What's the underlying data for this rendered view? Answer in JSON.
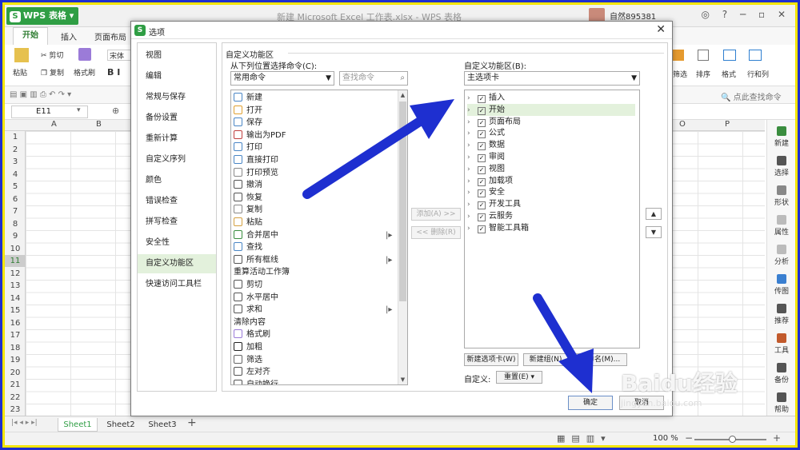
{
  "titlebar": {
    "app_name": "WPS 表格",
    "doc_title": "新建 Microsoft Excel 工作表.xlsx - WPS 表格",
    "user": "自然895381"
  },
  "ribbon": {
    "tabs": [
      "开始",
      "插入",
      "页面布局"
    ],
    "items": {
      "paste": "粘贴",
      "cut": "剪切",
      "copy": "复制",
      "format_painter": "格式刷",
      "font": "宋体",
      "filter": "筛选",
      "sort": "排序",
      "format": "格式",
      "rows_cols": "行和列",
      "find": "点此查找命令"
    }
  },
  "formula_bar": {
    "cell_ref": "E11"
  },
  "grid": {
    "columns": [
      "A",
      "B",
      "O",
      "P"
    ],
    "rows": [
      "1",
      "2",
      "3",
      "4",
      "5",
      "6",
      "7",
      "8",
      "9",
      "10",
      "11",
      "12",
      "13",
      "14",
      "15",
      "16",
      "17",
      "18",
      "19",
      "20",
      "21",
      "22",
      "23"
    ]
  },
  "right_sidebar": [
    "新建",
    "选择",
    "形状",
    "属性",
    "分析",
    "传图",
    "推荐",
    "工具",
    "备份",
    "帮助"
  ],
  "sheets": [
    "Sheet1",
    "Sheet2",
    "Sheet3"
  ],
  "status": {
    "zoom": "100 %"
  },
  "dialog": {
    "title": "选项",
    "nav": [
      "视图",
      "编辑",
      "常规与保存",
      "备份设置",
      "重新计算",
      "自定义序列",
      "颜色",
      "错误检查",
      "拼写检查",
      "安全性",
      "自定义功能区",
      "快速访问工具栏"
    ],
    "selected_nav": "自定义功能区",
    "section_title": "自定义功能区",
    "left": {
      "label": "从下列位置选择命令(C):",
      "combo": "常用命令",
      "search_placeholder": "查找命令",
      "commands": [
        "新建",
        "打开",
        "保存",
        "输出为PDF",
        "打印",
        "直接打印",
        "打印预览",
        "撤消",
        "恢复",
        "复制",
        "粘贴",
        "合并居中",
        "查找",
        "所有框线",
        "重算活动工作簿",
        "剪切",
        "水平居中",
        "求和",
        "清除内容",
        "格式刷",
        "加粗",
        "筛选",
        "左对齐",
        "自动换行"
      ]
    },
    "add_button": "添加(A) >>",
    "remove_button": "<< 删除(R)",
    "right": {
      "label": "自定义功能区(B):",
      "combo": "主选项卡",
      "tabs": [
        "插入",
        "开始",
        "页面布局",
        "公式",
        "数据",
        "审阅",
        "视图",
        "加载项",
        "安全",
        "开发工具",
        "云服务",
        "智能工具箱"
      ]
    },
    "new_tab_button": "新建选项卡(W)",
    "new_group_button": "新建组(N)",
    "rename_button": "重命名(M)...",
    "customize_label": "自定义:",
    "reset_button": "重置(E)",
    "ok_button": "确定",
    "cancel_button": "取消"
  },
  "watermark": {
    "brand": "Baidu经验",
    "url": "jingyan.baidu.com"
  },
  "colors": {
    "accent": "#2f9e44",
    "border": "#f3e500",
    "arrow": "#1e2fd0"
  }
}
